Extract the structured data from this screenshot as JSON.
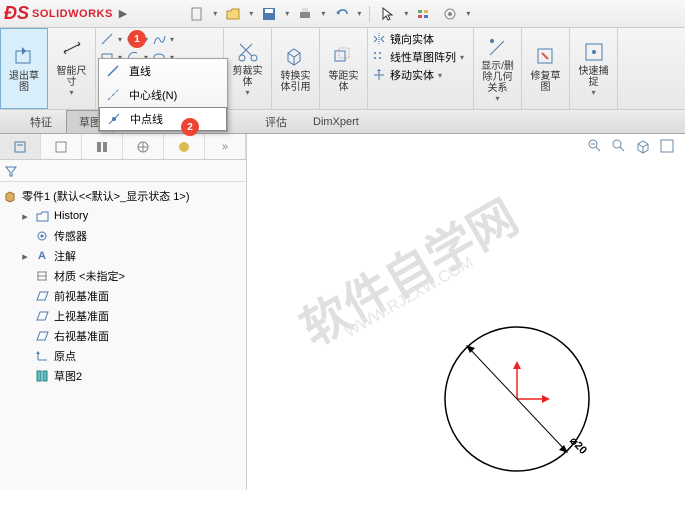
{
  "app": {
    "brand_prefix": "S",
    "brand": "SOLIDWORKS"
  },
  "ribbon": {
    "exit_sketch": "退出草图",
    "smart_dim": "智能尺寸",
    "trim": "剪裁实体",
    "convert": "转换实体引用",
    "offset": "等距实体",
    "mirror": "镜向实体",
    "linear_pattern": "线性草图阵列",
    "move": "移动实体",
    "display_delete": "显示/删除几何关系",
    "repair": "修复草图",
    "quick_snap": "快速捕捉"
  },
  "line_dropdown": {
    "line": "直线",
    "centerline": "中心线(N)",
    "midpoint_line": "中点线"
  },
  "tabs": {
    "feature": "特征",
    "sketch": "草图",
    "evaluate": "评估",
    "dimxpert": "DimXpert"
  },
  "tree": {
    "root": "零件1  (默认<<默认>_显示状态 1>)",
    "history": "History",
    "sensors": "传感器",
    "annotations": "注解",
    "material": "材质 <未指定>",
    "front": "前视基准面",
    "top": "上视基准面",
    "right": "右视基准面",
    "origin": "原点",
    "sketch": "草图2"
  },
  "canvas": {
    "watermark": "软件自学网",
    "watermark_sub": "WWW.RJZXW.COM",
    "dim": "⌀20"
  },
  "badges": {
    "b1": "1",
    "b2": "2"
  }
}
